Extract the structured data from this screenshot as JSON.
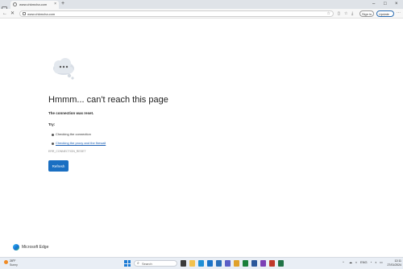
{
  "tab": {
    "title": "www.chkmcha.com",
    "close": "×",
    "new_tab": "+"
  },
  "window_controls": {
    "minimize": "–",
    "maximize": "□",
    "close": "×"
  },
  "toolbar": {
    "back": "←",
    "reload": "✕",
    "url": "www.chkmcha.com",
    "signin_label": "Sign in",
    "update_label": "Update",
    "menu": "⋯"
  },
  "error_page": {
    "heading": "Hmmm... can't reach this page",
    "reason": "The connection was reset.",
    "try_label": "Try:",
    "suggestions": [
      {
        "text": "Checking the connection",
        "is_link": false
      },
      {
        "text": "Checking the proxy and the firewall",
        "is_link": true
      }
    ],
    "error_code": "ERR_CONNECTION_RESET",
    "refresh_label": "Refresh",
    "brand": "Microsoft Edge"
  },
  "taskbar": {
    "weather_temp": "28°F",
    "weather_cond": "Sunny",
    "search_label": "Search",
    "search_icon": "⌕",
    "tray_caret": "^",
    "language": "ENG",
    "time": "12:11",
    "date": "27/01/2024"
  },
  "colors": {
    "accent": "#1a6fc2",
    "link": "#1a5fb4",
    "tab_strip": "#dfe3e8",
    "taskbar": "#e9eef5"
  }
}
